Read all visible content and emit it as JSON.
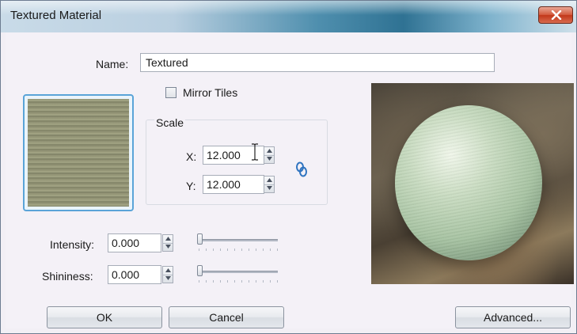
{
  "window": {
    "title": "Textured Material"
  },
  "name": {
    "label": "Name:",
    "value": "Textured"
  },
  "mirror_tiles": {
    "label": "Mirror Tiles",
    "checked": false
  },
  "scale": {
    "label": "Scale",
    "x": {
      "label": "X:",
      "value": "12.000"
    },
    "y": {
      "label": "Y:",
      "value": "12.000"
    },
    "link_icon": "link-chain-icon"
  },
  "intensity": {
    "label": "Intensity:",
    "value": "0.000",
    "slider_level": 0
  },
  "shininess": {
    "label": "Shininess:",
    "value": "0.000",
    "slider_level": 0
  },
  "buttons": {
    "ok": "OK",
    "cancel": "Cancel",
    "advanced": "Advanced..."
  },
  "icons": {
    "close": "close-icon",
    "cursor": "text-cursor-icon"
  },
  "colors": {
    "accent": "#5aa4d8",
    "close": "#c2381a",
    "titlebar": "#2f7293"
  }
}
